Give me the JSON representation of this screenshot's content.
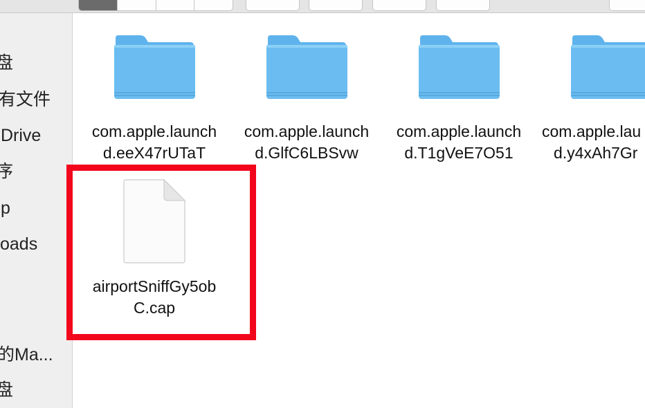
{
  "sidebar": {
    "items": [
      {
        "label": "盘"
      },
      {
        "label": "有文件"
      },
      {
        "label": "Drive"
      },
      {
        "label": "序"
      },
      {
        "label": "p"
      },
      {
        "label": "oads"
      },
      {
        "label": "的Ma..."
      },
      {
        "label": "盘"
      }
    ]
  },
  "files": [
    {
      "kind": "folder",
      "line1": "com.apple.launch",
      "line2": "d.eeX47rUTaT"
    },
    {
      "kind": "folder",
      "line1": "com.apple.launch",
      "line2": "d.GlfC6LBSvw"
    },
    {
      "kind": "folder",
      "line1": "com.apple.launch",
      "line2": "d.T1gVeE7O51"
    },
    {
      "kind": "folder",
      "line1": "com.apple.lau",
      "line2": "d.y4xAh7Gr"
    },
    {
      "kind": "document",
      "line1": "airportSniffGy5ob",
      "line2": "C.cap"
    }
  ],
  "colors": {
    "highlight": "#f2061c",
    "folder_body": "#6bbcf0",
    "folder_tab": "#5fb3ec"
  }
}
